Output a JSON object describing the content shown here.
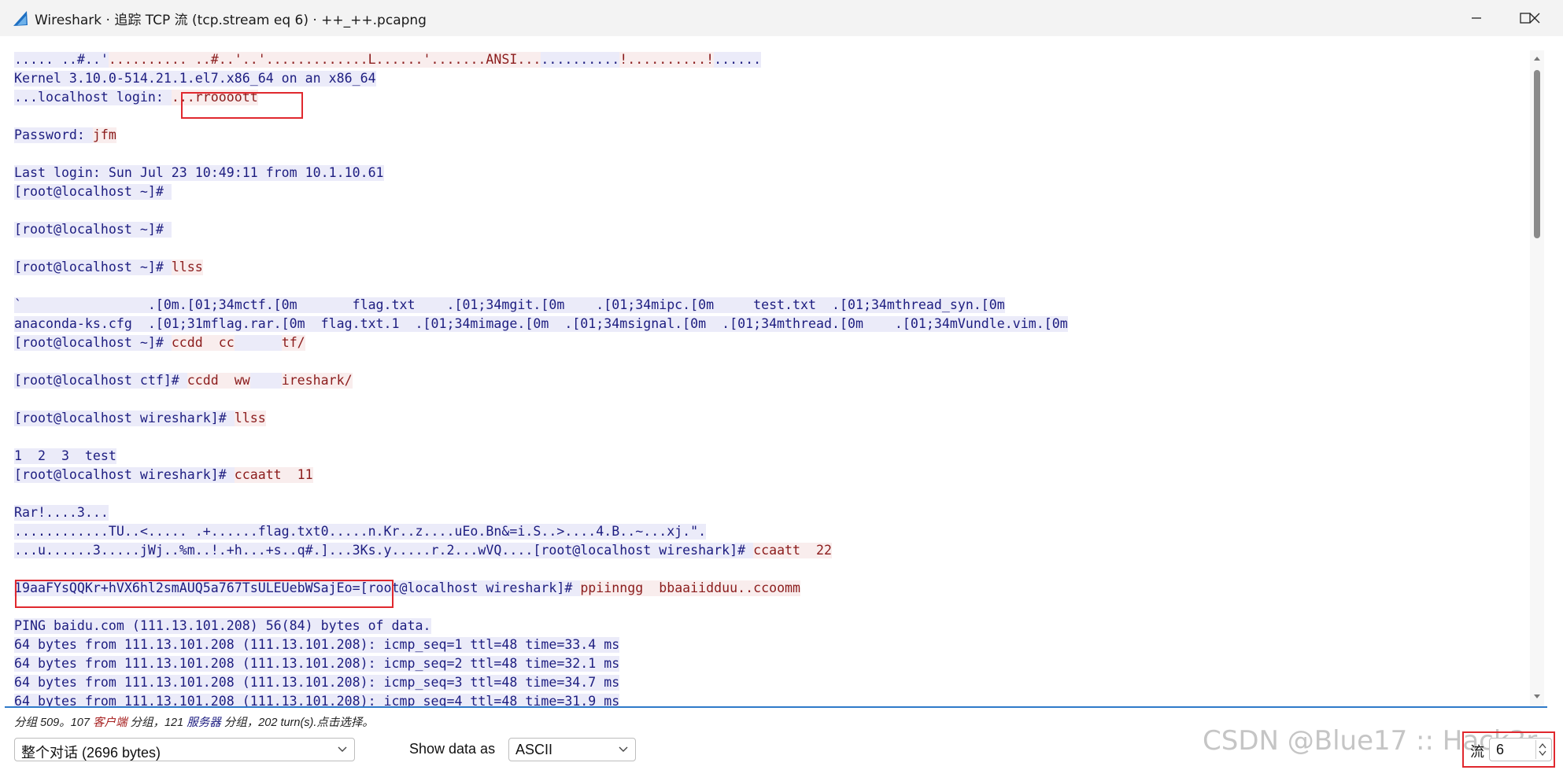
{
  "window": {
    "title": "Wireshark · 追踪 TCP 流 (tcp.stream eq 6) · ++_++.pcapng",
    "minimize_icon": "minimize-icon",
    "maximize_icon": "maximize-icon",
    "close_icon": "close-icon",
    "app_icon": "wireshark-fin-icon"
  },
  "colors": {
    "client_bg": "#f9eded",
    "client_fg": "#8b1c1c",
    "server_bg": "#ebebf9",
    "server_fg": "#1d1d80",
    "highlight_border": "#e0282e"
  },
  "stream": {
    "lines": [
      [
        {
          "t": "..... ..#..'",
          "s": "s"
        },
        {
          "t": ".......... ..#..'..'.............L......'.......ANSI...",
          "s": "c"
        },
        {
          "t": "..........",
          "s": "s"
        },
        {
          "t": "!..........!",
          "s": "c"
        },
        {
          "t": "......",
          "s": "s"
        }
      ],
      [
        {
          "t": "Kernel 3.10.0-514.21.1.el7.x86_64 on an x86_64",
          "s": "s"
        }
      ],
      [
        {
          "t": "...localhost login: ",
          "s": "s"
        },
        {
          "t": "...rroooott",
          "s": "c"
        }
      ],
      [],
      [
        {
          "t": "Password: ",
          "s": "s"
        },
        {
          "t": "jfm",
          "s": "c"
        }
      ],
      [],
      [
        {
          "t": "Last login: Sun Jul 23 10:49:11 from 10.1.10.61",
          "s": "s"
        }
      ],
      [
        {
          "t": "[root@localhost ~]# ",
          "s": "s"
        }
      ],
      [],
      [
        {
          "t": "[root@localhost ~]# ",
          "s": "s"
        }
      ],
      [],
      [
        {
          "t": "[root@localhost ~]# ",
          "s": "s"
        },
        {
          "t": "llss",
          "s": "c"
        }
      ],
      [],
      [
        {
          "t": "`                .[0m.[01;34mctf.[0m       flag.txt    .[01;34mgit.[0m    .[01;34mipc.[0m     test.txt  .[01;34mthread_syn.[0m",
          "s": "s"
        }
      ],
      [
        {
          "t": "anaconda-ks.cfg  .[01;31mflag.rar.[0m  flag.txt.1  .[01;34mimage.[0m  .[01;34msignal.[0m  .[01;34mthread.[0m    .[01;34mVundle.vim.[0m",
          "s": "s"
        }
      ],
      [
        {
          "t": "[root@localhost ~]# ",
          "s": "s"
        },
        {
          "t": "ccdd  cc",
          "s": "c"
        },
        {
          "t": "      ",
          "s": "s"
        },
        {
          "t": "tf/",
          "s": "c"
        }
      ],
      [],
      [
        {
          "t": "[root@localhost ctf]# ",
          "s": "s"
        },
        {
          "t": "ccdd  ww",
          "s": "c"
        },
        {
          "t": "    ",
          "s": "s"
        },
        {
          "t": "ireshark/",
          "s": "c"
        }
      ],
      [],
      [
        {
          "t": "[root@localhost wireshark]# ",
          "s": "s"
        },
        {
          "t": "llss",
          "s": "c"
        }
      ],
      [],
      [
        {
          "t": "1  2  3  test",
          "s": "s"
        }
      ],
      [
        {
          "t": "[root@localhost wireshark]# ",
          "s": "s"
        },
        {
          "t": "ccaatt  11",
          "s": "c"
        }
      ],
      [],
      [
        {
          "t": "Rar!....3...",
          "s": "s"
        }
      ],
      [
        {
          "t": "............TU..<..... .+......flag.txt0.....n.Kr..z....uEo.Bn&=i.S..>....4.B..~...xj.\".",
          "s": "s"
        }
      ],
      [
        {
          "t": "...u......3.....jWj..%m..!.+h...+s..q#.]...3Ks.y.....r.2...wVQ....[root@localhost wireshark]# ",
          "s": "s"
        },
        {
          "t": "ccaatt  22",
          "s": "c"
        }
      ],
      [],
      [
        {
          "t": "19aaFYsQQKr+hVX6hl2smAUQ5a767TsULEUebWSajEo=",
          "s": "s"
        },
        {
          "t": "[root@localhost wireshark]# ",
          "s": "s"
        },
        {
          "t": "ppiinngg  bbaaiidduu..ccoomm",
          "s": "c"
        }
      ],
      [],
      [
        {
          "t": "PING baidu.com (111.13.101.208) 56(84) bytes of data.",
          "s": "s"
        }
      ],
      [
        {
          "t": "64 bytes from 111.13.101.208 (111.13.101.208): icmp_seq=1 ttl=48 time=33.4 ms",
          "s": "s"
        }
      ],
      [
        {
          "t": "64 bytes from 111.13.101.208 (111.13.101.208): icmp_seq=2 ttl=48 time=32.1 ms",
          "s": "s"
        }
      ],
      [
        {
          "t": "64 bytes from 111.13.101.208 (111.13.101.208): icmp_seq=3 ttl=48 time=34.7 ms",
          "s": "s"
        }
      ],
      [
        {
          "t": "64 bytes from 111.13.101.208 (111.13.101.208): icmp_seq=4 ttl=48 time=31.9 ms",
          "s": "s"
        }
      ]
    ]
  },
  "status": {
    "prefix": "分组 509。107 ",
    "client_label": "客户端",
    "mid1": " 分组，121 ",
    "server_label": "服务器",
    "suffix": " 分组，202 turn(s).点击选择。"
  },
  "controls": {
    "conversation_value": "整个对话 (2696 bytes)",
    "show_data_label": "Show data as",
    "show_data_value": "ASCII",
    "stream_label": "流",
    "stream_value": "6"
  },
  "watermark": "CSDN @Blue17 :: Hack3r"
}
